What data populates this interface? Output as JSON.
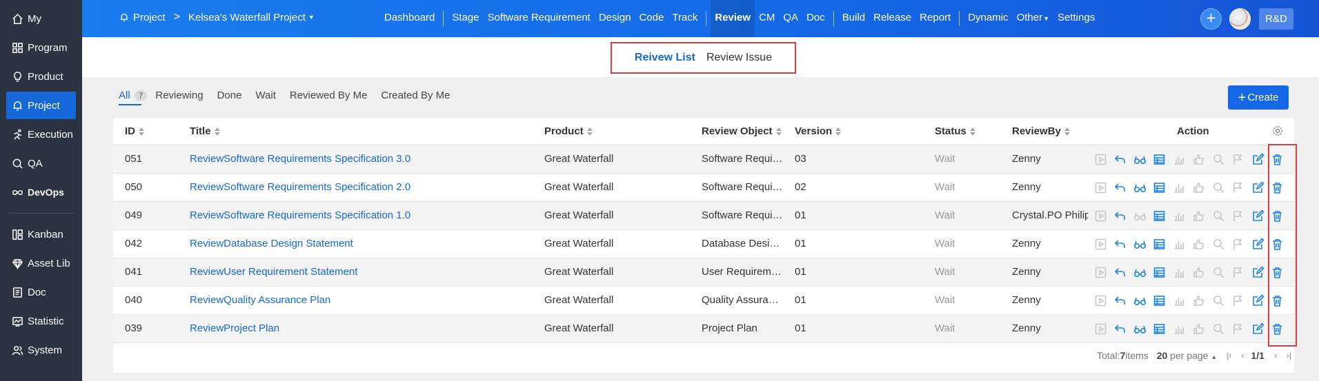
{
  "sidebar": {
    "items": [
      {
        "label": "My",
        "icon": "home-icon"
      },
      {
        "label": "Program",
        "icon": "grid-icon"
      },
      {
        "label": "Product",
        "icon": "lightbulb-icon"
      },
      {
        "label": "Project",
        "icon": "bell-icon",
        "active": true
      },
      {
        "label": "Execution",
        "icon": "running-icon"
      },
      {
        "label": "QA",
        "icon": "magnifier-icon"
      },
      {
        "label": "DevOps",
        "icon": "infinity-icon"
      },
      {
        "label": "Kanban",
        "icon": "kanban-icon"
      },
      {
        "label": "Asset Lib",
        "icon": "diamond-icon"
      },
      {
        "label": "Doc",
        "icon": "document-icon"
      },
      {
        "label": "Statistic",
        "icon": "chart-icon"
      },
      {
        "label": "System",
        "icon": "users-icon"
      }
    ]
  },
  "topbar": {
    "project_label": "Project",
    "separator": ">",
    "project_name": "Kelsea's Waterfall Project",
    "nav": [
      "Dashboard",
      "Stage",
      "Software Requirement",
      "Design",
      "Code",
      "Track",
      "Review",
      "CM",
      "QA",
      "Doc",
      "Build",
      "Release",
      "Report",
      "Dynamic",
      "Other",
      "Settings"
    ],
    "active_nav": "Review",
    "rd_label": "R&D",
    "plus_label": "+"
  },
  "subtabs": {
    "list": "Reivew List",
    "issue": "Review Issue"
  },
  "filters": {
    "all": "All",
    "all_count": "7",
    "reviewing": "Reviewing",
    "done": "Done",
    "wait": "Wait",
    "reviewed_by_me": "Reviewed By Me",
    "created_by_me": "Created By Me"
  },
  "create_label": "Create",
  "table": {
    "headers": {
      "id": "ID",
      "title": "Title",
      "product": "Product",
      "review_object": "Review Object",
      "version": "Version",
      "status": "Status",
      "review_by": "ReviewBy",
      "action": "Action"
    },
    "rows": [
      {
        "id": "051",
        "title": "ReviewSoftware Requirements Specification 3.0",
        "product": "Great Waterfall",
        "object": "Software Requi…",
        "version": "03",
        "status": "Wait",
        "review_by": "Zenny"
      },
      {
        "id": "050",
        "title": "ReviewSoftware Requirements Specification 2.0",
        "product": "Great Waterfall",
        "object": "Software Requi…",
        "version": "02",
        "status": "Wait",
        "review_by": "Zenny"
      },
      {
        "id": "049",
        "title": "ReviewSoftware Requirements Specification 1.0",
        "product": "Great Waterfall",
        "object": "Software Requi…",
        "version": "01",
        "status": "Wait",
        "review_by": "Crystal.PO  Philip"
      },
      {
        "id": "042",
        "title": "ReviewDatabase Design Statement",
        "product": "Great Waterfall",
        "object": "Database Desi…",
        "version": "01",
        "status": "Wait",
        "review_by": "Zenny"
      },
      {
        "id": "041",
        "title": "ReviewUser Requirement Statement",
        "product": "Great Waterfall",
        "object": "User Requirem…",
        "version": "01",
        "status": "Wait",
        "review_by": "Zenny"
      },
      {
        "id": "040",
        "title": "ReviewQuality Assurance Plan",
        "product": "Great Waterfall",
        "object": "Quality Assura…",
        "version": "01",
        "status": "Wait",
        "review_by": "Zenny"
      },
      {
        "id": "039",
        "title": "ReviewProject Plan",
        "product": "Great Waterfall",
        "object": "Project Plan",
        "version": "01",
        "status": "Wait",
        "review_by": "Zenny"
      }
    ]
  },
  "pager": {
    "total_prefix": "Total: ",
    "total": "7",
    "total_suffix": " items",
    "per_page": "20",
    "per_page_suffix": " per page",
    "page": "1/1"
  },
  "colors": {
    "sidebar_bg": "#2b3340",
    "accent": "#1468e6",
    "highlight_box": "#e03a3a"
  }
}
